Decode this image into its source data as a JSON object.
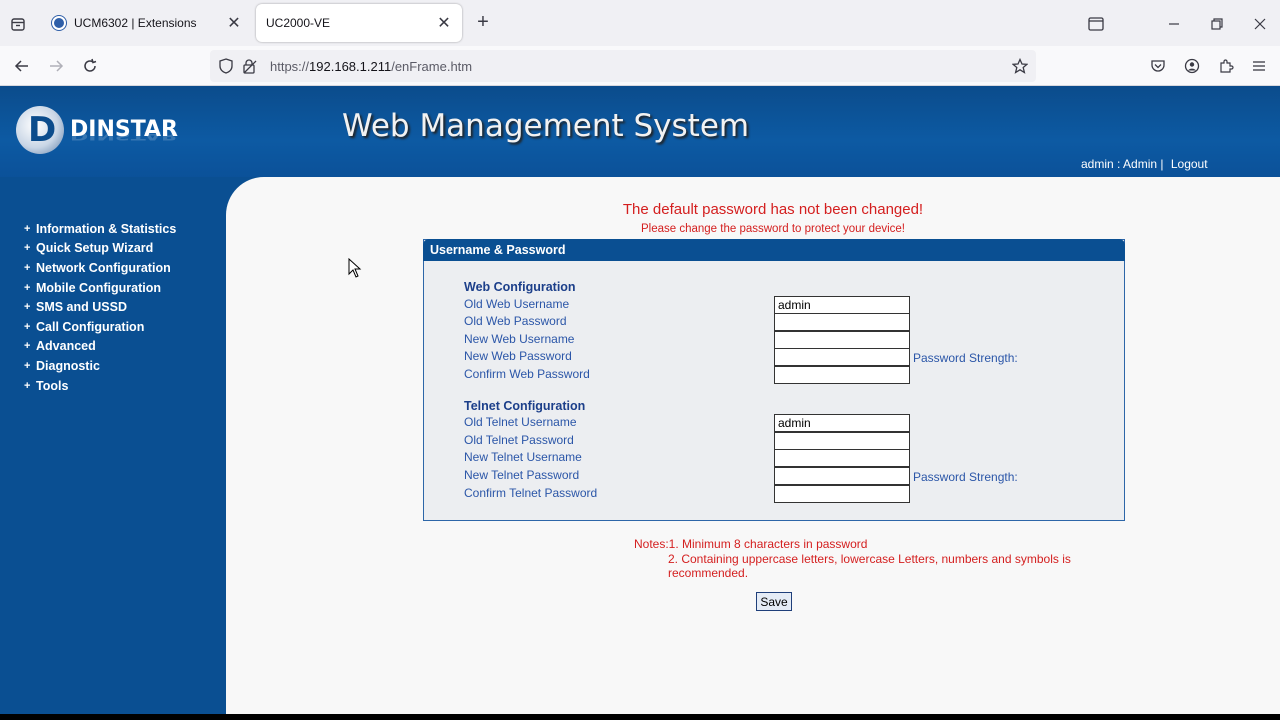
{
  "browser": {
    "tabs": [
      {
        "title": "UCM6302 | Extensions",
        "active": false
      },
      {
        "title": "UC2000-VE",
        "active": true
      }
    ],
    "url": {
      "scheme": "https://",
      "host": "192.168.1.211",
      "path": "/enFrame.htm"
    }
  },
  "header": {
    "logo_text": "DINSTAR",
    "logo_letter": "D",
    "title": "Web Management System",
    "user_label": "admin : Admin |",
    "logout": "Logout"
  },
  "sidebar": {
    "items": [
      {
        "label": "Information & Statistics"
      },
      {
        "label": "Quick Setup Wizard"
      },
      {
        "label": "Network Configuration"
      },
      {
        "label": "Mobile Configuration"
      },
      {
        "label": "SMS and USSD"
      },
      {
        "label": "Call Configuration"
      },
      {
        "label": "Advanced"
      },
      {
        "label": "Diagnostic"
      },
      {
        "label": "Tools"
      }
    ]
  },
  "main": {
    "warning_title": "The default password has not been changed!",
    "warning_sub": "Please change the password to protect your device!",
    "panel_title": "Username & Password",
    "web": {
      "section": "Web Configuration",
      "old_username_label": "Old Web Username",
      "old_username_value": "admin",
      "old_password_label": "Old Web Password",
      "new_username_label": "New Web Username",
      "new_password_label": "New Web Password",
      "confirm_password_label": "Confirm Web Password",
      "strength_label": "Password Strength:"
    },
    "telnet": {
      "section": "Telnet Configuration",
      "old_username_label": "Old Telnet Username",
      "old_username_value": "admin",
      "old_password_label": "Old Telnet Password",
      "new_username_label": "New Telnet Username",
      "new_password_label": "New Telnet Password",
      "confirm_password_label": "Confirm Telnet Password",
      "strength_label": "Password Strength:"
    },
    "notes_line1": "Notes:1. Minimum 8 characters in password",
    "notes_line2": "2. Containing uppercase letters, lowercase Letters, numbers and symbols is recommended.",
    "save_label": "Save"
  }
}
